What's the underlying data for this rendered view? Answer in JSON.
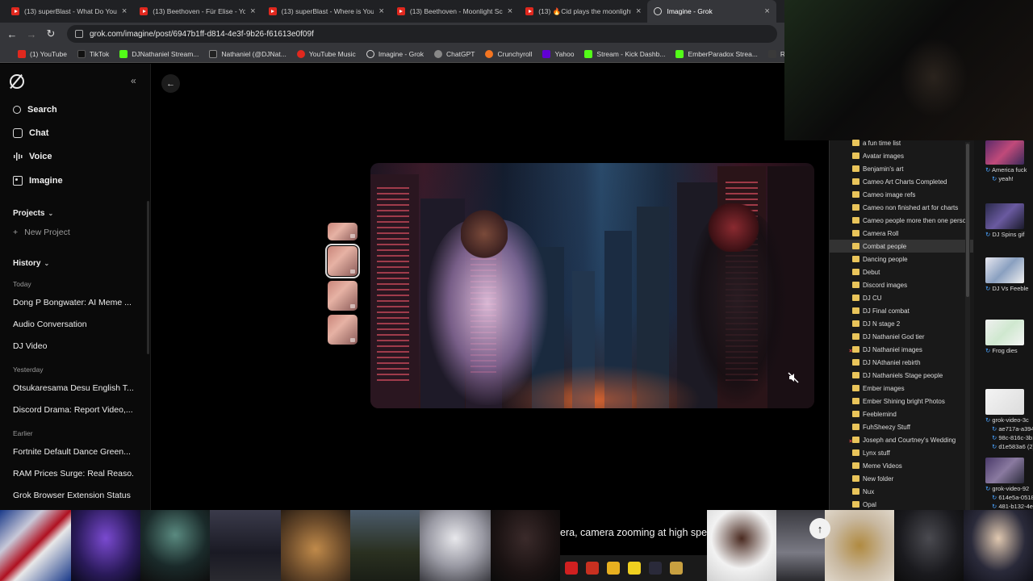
{
  "browser": {
    "tabs": [
      {
        "title": "(13) superBlast - What Do You",
        "favicon": "youtube-icon",
        "active": false
      },
      {
        "title": "(13) Beethoven - Für Elise - You",
        "favicon": "youtube-icon",
        "active": false
      },
      {
        "title": "(13) superBlast - Where is Your",
        "favicon": "youtube-icon",
        "active": false
      },
      {
        "title": "(13) Beethoven - Moonlight Sc",
        "favicon": "youtube-icon",
        "active": false
      },
      {
        "title": "(13) 🔥Cid plays the moonlight",
        "favicon": "youtube-icon",
        "active": false
      },
      {
        "title": "Imagine - Grok",
        "favicon": "grok-icon",
        "active": true
      }
    ],
    "close_glyph": "×",
    "new_tab_glyph": "+",
    "url": "grok.com/imagine/post/6947b1ff-d814-4e3f-9b26-f61613e0f09f",
    "bookmarks": [
      {
        "label": "(1) YouTube",
        "color": "#e0281e"
      },
      {
        "label": "TikTok",
        "color": "#111111"
      },
      {
        "label": "DJNathaniel Stream...",
        "color": "#53fc18"
      },
      {
        "label": "Nathaniel (@DJNat...",
        "color": "#222222"
      },
      {
        "label": "YouTube Music",
        "color": "#e0281e"
      },
      {
        "label": "Imagine - Grok",
        "color": "#333333"
      },
      {
        "label": "ChatGPT",
        "color": "#777777"
      },
      {
        "label": "Crunchyroll",
        "color": "#f47521"
      },
      {
        "label": "Yahoo",
        "color": "#6001d2"
      },
      {
        "label": "Stream - Kick Dashb...",
        "color": "#53fc18"
      },
      {
        "label": "EmberParadox Strea...",
        "color": "#53fc18"
      },
      {
        "label": "RuneScape Online",
        "color": "#2a2a2a"
      }
    ]
  },
  "sidebar": {
    "nav": [
      {
        "label": "Search",
        "icon": "search-icon"
      },
      {
        "label": "Chat",
        "icon": "chat-icon"
      },
      {
        "label": "Voice",
        "icon": "voice-icon"
      },
      {
        "label": "Imagine",
        "icon": "image-icon"
      }
    ],
    "projects_label": "Projects",
    "new_project_label": "New Project",
    "history_label": "History",
    "groups": [
      {
        "day": "Today",
        "items": [
          "Dong P Bongwater: AI Meme ...",
          "Audio Conversation",
          "DJ Video"
        ]
      },
      {
        "day": "Yesterday",
        "items": [
          "Otsukaresama Desu English T...",
          "Discord Drama: Report Video,..."
        ]
      },
      {
        "day": "Earlier",
        "items": [
          "Fortnite Default Dance Green...",
          "RAM Prices Surge: Real Reaso...",
          "Grok Browser Extension Status"
        ]
      }
    ]
  },
  "explorer": {
    "folders": [
      "a fun time list",
      "Avatar images",
      "Benjamin's art",
      "Cameo Art Charts Completed",
      "Cameo image refs",
      "Cameo non finished art for charts",
      "Cameo people more then one perso",
      "Camera Roll",
      "Combat people",
      "Dancing people",
      "Debut",
      "Discord images",
      "DJ CU",
      "DJ Final combat",
      "DJ N stage 2",
      "DJ Nathaniel God tier",
      "DJ Nathaniel images",
      "DJ NAthaniel rebirth",
      "DJ Nathaniels Stage people",
      "Ember images",
      "Ember Shining bright Photos",
      "Feeblemind",
      "FuhSheezy Stuff",
      "Joseph and Courtney's Wedding",
      "Lynx stuff",
      "Meme Videos",
      "New folder",
      "Nux",
      "Opal"
    ],
    "highlighted": "Combat people",
    "files": [
      {
        "name": "America fuck",
        "name2": "yeah!"
      },
      {
        "name": "DJ Spins gif",
        "name2": ""
      },
      {
        "name": "DJ Vs Feeble",
        "name2": ""
      },
      {
        "name": "Frog dies",
        "name2": ""
      },
      {
        "name": "grok-video-3c",
        "name2": "ae717a-a394-4",
        "name3": "98c-816c-3b1",
        "name4": "d1e583a6 (2)"
      },
      {
        "name": "grok-video-92",
        "name2": "614e5a-0518-4",
        "name3": "481-b132-4e6"
      }
    ]
  },
  "gallery": {
    "prompt_snippet": "era, camera zooming at high speed"
  }
}
